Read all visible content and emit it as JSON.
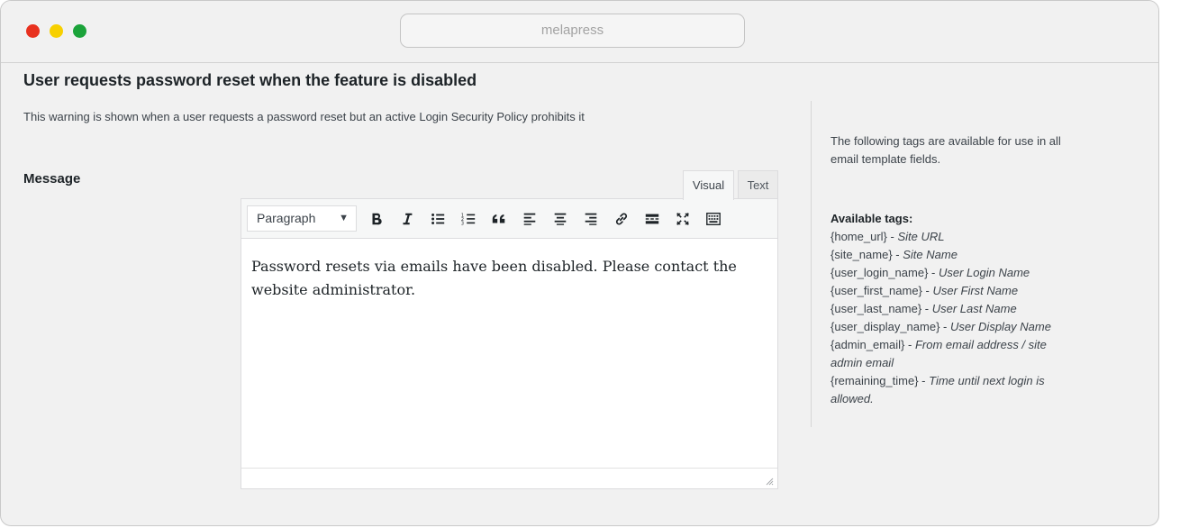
{
  "window": {
    "address": "melapress"
  },
  "section": {
    "title": "User requests password reset when the feature is disabled",
    "description": "This warning is shown when a user requests a password reset but an active Login Security Policy prohibits it",
    "message_label": "Message"
  },
  "editor": {
    "tabs": {
      "visual": "Visual",
      "text": "Text",
      "active": "Visual"
    },
    "format_select": "Paragraph",
    "toolbar_icons": [
      "bold-icon",
      "italic-icon",
      "bulleted-list-icon",
      "numbered-list-icon",
      "blockquote-icon",
      "align-left-icon",
      "align-center-icon",
      "align-right-icon",
      "link-icon",
      "read-more-icon",
      "fullscreen-icon",
      "toolbar-toggle-icon"
    ],
    "content": "Password resets via emails have been disabled. Please contact the website administrator."
  },
  "sidebar": {
    "intro": "The following tags are available for use in all email template fields.",
    "tags_title": "Available tags:",
    "tags": [
      {
        "tag": "{home_url}",
        "desc": "Site URL"
      },
      {
        "tag": "{site_name}",
        "desc": "Site Name"
      },
      {
        "tag": "{user_login_name}",
        "desc": "User Login Name"
      },
      {
        "tag": "{user_first_name}",
        "desc": "User First Name"
      },
      {
        "tag": "{user_last_name}",
        "desc": "User Last Name"
      },
      {
        "tag": "{user_display_name}",
        "desc": "User Display Name"
      },
      {
        "tag": "{admin_email}",
        "desc": "From email address / site admin email"
      },
      {
        "tag": "{remaining_time}",
        "desc": "Time until next login is allowed."
      }
    ]
  },
  "colors": {
    "close": "#e8311f",
    "minimize": "#f7d000",
    "maximize": "#1ba33a"
  }
}
